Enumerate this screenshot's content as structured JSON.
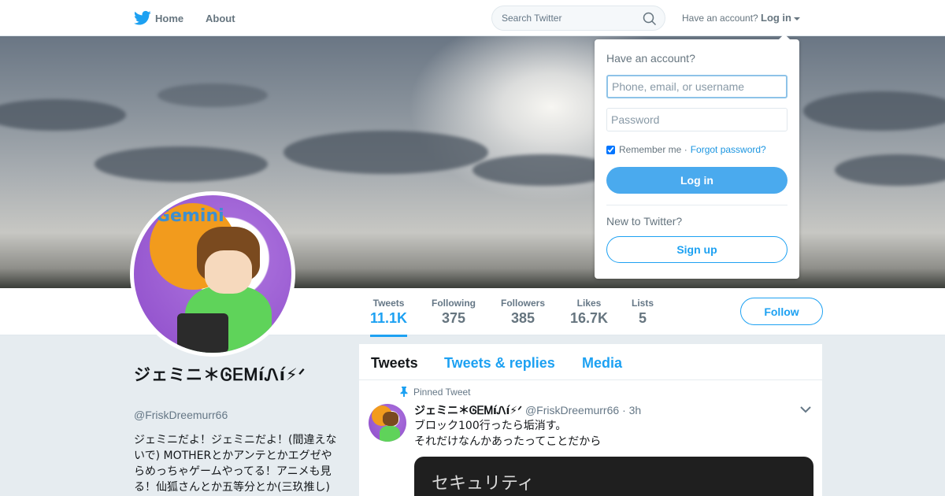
{
  "nav": {
    "home_label": "Home",
    "about_label": "About",
    "search_placeholder": "Search Twitter",
    "have_account": "Have an account?",
    "login_label": "Log in"
  },
  "profile": {
    "name": "ジェミニ＊ᎶᎬᎷíᏁí⚡︎ᐟ",
    "handle": "@FriskDreemurr66",
    "bio": "ジェミニだよ！ジェミニだよ！(間違えないで) MOTHERとかアンテとかエグゼやらめっちゃゲームやってる！アニメも見る！仙狐さんとか五等分とか(三玖推し)",
    "avatar_text": "Gemini"
  },
  "stats": [
    {
      "label": "Tweets",
      "value": "11.1K"
    },
    {
      "label": "Following",
      "value": "375"
    },
    {
      "label": "Followers",
      "value": "385"
    },
    {
      "label": "Likes",
      "value": "16.7K"
    },
    {
      "label": "Lists",
      "value": "5"
    }
  ],
  "follow_label": "Follow",
  "tabs": [
    "Tweets",
    "Tweets & replies",
    "Media"
  ],
  "tweet": {
    "pinned_label": "Pinned Tweet",
    "name": "ジェミニ＊ᎶᎬᎷíᏁí⚡︎ᐟ",
    "handle": "@FriskDreemurr66",
    "time": "· 3h",
    "line1": "ブロック100行ったら垢消す。",
    "line2": "それだけなんかあったってことだから",
    "media_text": "セキュリティ"
  },
  "login_dropdown": {
    "title": "Have an account?",
    "username_placeholder": "Phone, email, or username",
    "password_placeholder": "Password",
    "remember_label": "Remember me ·",
    "forgot_label": "Forgot password?",
    "login_button": "Log in",
    "new_label": "New to Twitter?",
    "signup_button": "Sign up"
  },
  "colors": {
    "accent": "#1da1f2",
    "login_button": "#4aaaee"
  }
}
